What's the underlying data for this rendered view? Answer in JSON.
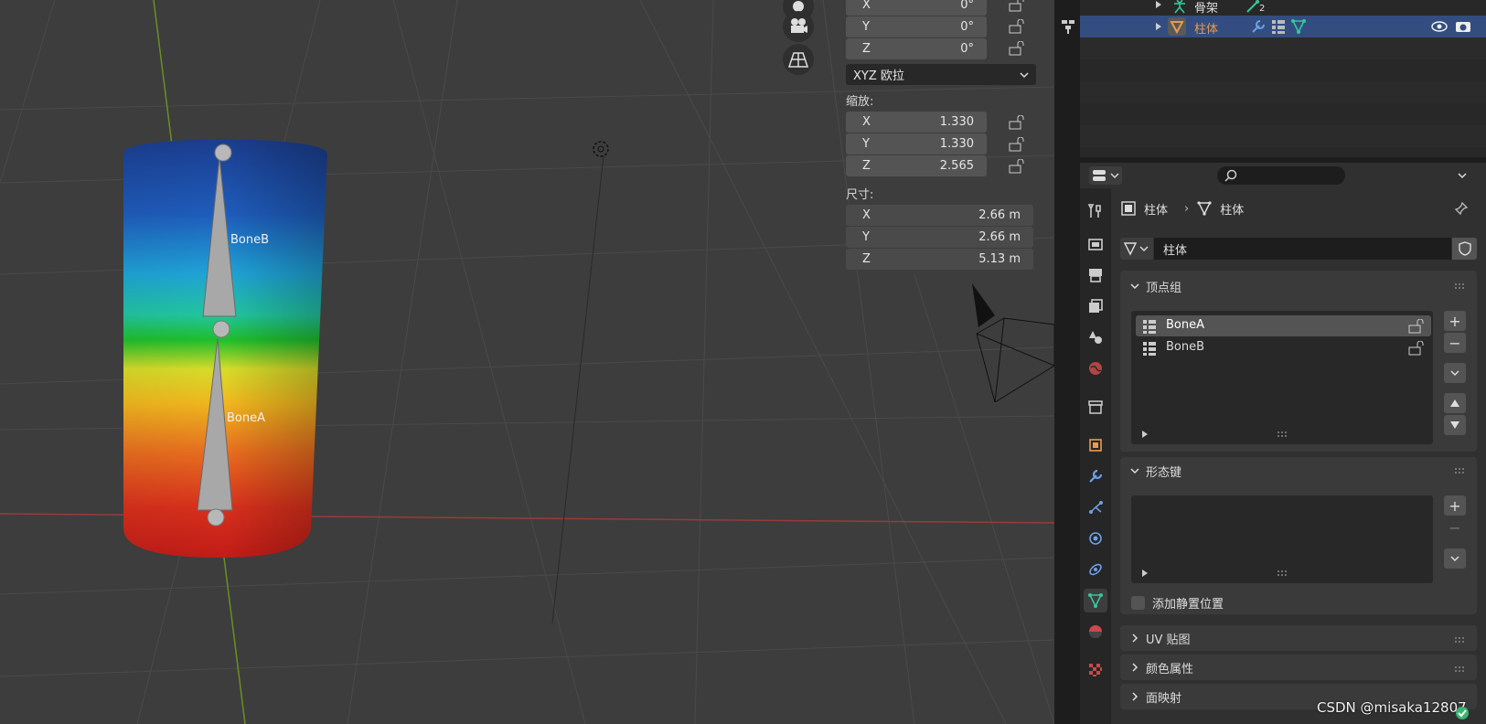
{
  "viewport": {
    "bone_labels": [
      "BoneB",
      "BoneA"
    ]
  },
  "npanel": {
    "rotation_fields": [
      {
        "axis": "X",
        "value": "0°"
      },
      {
        "axis": "Y",
        "value": "0°"
      },
      {
        "axis": "Z",
        "value": "0°"
      }
    ],
    "rotation_mode": "XYZ 欧拉",
    "scale_label": "缩放:",
    "scale_fields": [
      {
        "axis": "X",
        "value": "1.330"
      },
      {
        "axis": "Y",
        "value": "1.330"
      },
      {
        "axis": "Z",
        "value": "2.565"
      }
    ],
    "dims_label": "尺寸:",
    "dims_fields": [
      {
        "axis": "X",
        "value": "2.66 m"
      },
      {
        "axis": "Y",
        "value": "2.66 m"
      },
      {
        "axis": "Z",
        "value": "5.13 m"
      }
    ]
  },
  "outliner": {
    "row1": {
      "name": "骨架",
      "badge": "2"
    },
    "row2": {
      "name": "柱体"
    }
  },
  "properties": {
    "breadcrumb": {
      "object": "柱体",
      "mesh": "柱体"
    },
    "mesh_name": "柱体",
    "vertex_groups": {
      "title": "顶点组",
      "items": [
        "BoneA",
        "BoneB"
      ]
    },
    "shape_keys": {
      "title": "形态键",
      "relative_label": "添加静置位置"
    },
    "uv_maps": {
      "title": "UV 贴图"
    },
    "color_attrs": {
      "title": "颜色属性"
    },
    "face_maps": {
      "title": "面映射"
    }
  },
  "watermark": "CSDN @misaka12807",
  "colors": {
    "selected_row": "#334d80",
    "accent_orange": "#e89b4d",
    "mesh_green": "#35c79b"
  }
}
